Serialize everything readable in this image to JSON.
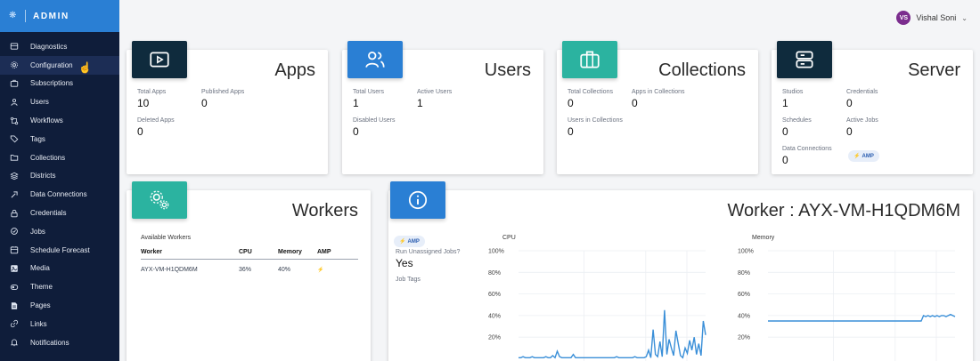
{
  "brand": {
    "label": "ADMIN"
  },
  "nav": {
    "items": [
      {
        "label": "Diagnostics",
        "icon": "diagnostics-icon"
      },
      {
        "label": "Configuration",
        "icon": "gear-icon",
        "active": true
      },
      {
        "label": "Subscriptions",
        "icon": "subscriptions-icon"
      },
      {
        "label": "Users",
        "icon": "user-icon"
      },
      {
        "label": "Workflows",
        "icon": "workflow-icon"
      },
      {
        "label": "Tags",
        "icon": "tag-icon"
      },
      {
        "label": "Collections",
        "icon": "folder-icon"
      },
      {
        "label": "Districts",
        "icon": "districts-icon"
      },
      {
        "label": "Data Connections",
        "icon": "connection-icon"
      },
      {
        "label": "Credentials",
        "icon": "lock-icon"
      },
      {
        "label": "Jobs",
        "icon": "jobs-icon"
      },
      {
        "label": "Schedule Forecast",
        "icon": "calendar-icon"
      },
      {
        "label": "Media",
        "icon": "media-icon"
      },
      {
        "label": "Theme",
        "icon": "theme-icon"
      },
      {
        "label": "Pages",
        "icon": "page-icon"
      },
      {
        "label": "Links",
        "icon": "link-icon"
      },
      {
        "label": "Notifications",
        "icon": "bell-icon"
      }
    ]
  },
  "user": {
    "initials": "VS",
    "name": "Vishal Soni",
    "caret": "⌄"
  },
  "apps": {
    "title": "Apps",
    "total_label": "Total Apps",
    "total_value": "10",
    "published_label": "Published Apps",
    "published_value": "0",
    "deleted_label": "Deleted Apps",
    "deleted_value": "0"
  },
  "users": {
    "title": "Users",
    "total_label": "Total Users",
    "total_value": "1",
    "active_label": "Active Users",
    "active_value": "1",
    "disabled_label": "Disabled Users",
    "disabled_value": "0"
  },
  "collections": {
    "title": "Collections",
    "total_label": "Total Collections",
    "total_value": "0",
    "apps_label": "Apps in Collections",
    "apps_value": "0",
    "users_label": "Users in Collections",
    "users_value": "0"
  },
  "server": {
    "title": "Server",
    "studios_label": "Studios",
    "studios_value": "1",
    "credentials_label": "Credentials",
    "credentials_value": "0",
    "schedules_label": "Schedules",
    "schedules_value": "0",
    "activejobs_label": "Active Jobs",
    "activejobs_value": "0",
    "dataconn_label": "Data Connections",
    "dataconn_value": "0",
    "amp_label": "AMP"
  },
  "workers": {
    "title": "Workers",
    "available_label": "Available Workers",
    "columns": [
      "Worker",
      "CPU",
      "Memory",
      "AMP"
    ],
    "rows": [
      {
        "worker": "AYX-VM-H1QDM6M",
        "cpu": "36%",
        "memory": "40%",
        "amp": "⚡"
      }
    ]
  },
  "worker_detail": {
    "title": "Worker : AYX-VM-H1QDM6M",
    "amp_label": "AMP",
    "run_unassigned_label": "Run Unassigned Jobs?",
    "run_unassigned_value": "Yes",
    "job_tags_label": "Job Tags",
    "cpu_title": "CPU",
    "memory_title": "Memory"
  },
  "colors": {
    "sidebar": "#0f1d3a",
    "brand": "#2a7fd4",
    "apps_badge": "#0f2b3d",
    "users_badge": "#2a7fd4",
    "collections_badge": "#2bb3a0",
    "server_badge": "#0f2b3d",
    "workers_badge": "#2bb3a0",
    "worker_badge": "#2a7fd4",
    "line": "#3a8fd8"
  },
  "chart_data": [
    {
      "type": "line",
      "title": "CPU",
      "yticks": [
        "100%",
        "80%",
        "60%",
        "40%",
        "20%"
      ],
      "ylim": [
        0,
        100
      ],
      "series": [
        {
          "values": [
            1,
            1,
            2,
            1,
            1,
            1,
            2,
            1,
            1,
            1,
            1,
            1,
            2,
            1,
            1,
            3,
            1,
            7,
            2,
            1,
            1,
            1,
            1,
            1,
            4,
            1,
            1,
            1,
            1,
            1,
            1,
            1,
            1,
            1,
            1,
            1,
            1,
            1,
            1,
            1,
            1,
            1,
            1,
            2,
            1,
            1,
            1,
            1,
            1,
            1,
            1,
            2,
            1,
            1,
            1,
            1,
            2,
            8,
            1,
            27,
            4,
            2,
            16,
            2,
            45,
            4,
            18,
            10,
            3,
            26,
            14,
            3,
            1,
            10,
            5,
            17,
            8,
            20,
            4,
            14,
            3,
            35,
            22
          ]
        }
      ]
    },
    {
      "type": "line",
      "title": "Memory",
      "yticks": [
        "100%",
        "80%",
        "60%",
        "40%",
        "20%"
      ],
      "ylim": [
        0,
        100
      ],
      "series": [
        {
          "values": [
            35,
            35,
            35,
            35,
            35,
            35,
            35,
            35,
            35,
            35,
            35,
            35,
            35,
            35,
            35,
            35,
            35,
            35,
            35,
            35,
            35,
            35,
            35,
            35,
            35,
            35,
            35,
            35,
            35,
            35,
            35,
            35,
            35,
            35,
            35,
            35,
            35,
            35,
            35,
            35,
            35,
            35,
            35,
            35,
            35,
            35,
            35,
            35,
            35,
            35,
            35,
            35,
            35,
            35,
            35,
            35,
            35,
            35,
            35,
            35,
            35,
            35,
            35,
            35,
            35,
            35,
            35,
            35,
            35,
            40,
            39,
            40,
            39,
            40,
            39,
            40,
            39,
            40,
            40,
            39,
            40,
            41,
            40,
            39
          ]
        }
      ]
    }
  ]
}
